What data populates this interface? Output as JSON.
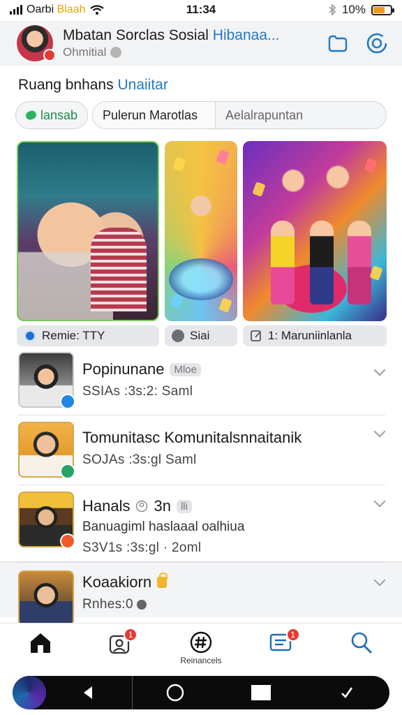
{
  "status_bar": {
    "carrier": "Oarbi",
    "carrier_accent": "Blaah",
    "time": "11:34",
    "battery_text": "10%",
    "battery_level": 0.65,
    "battery_color": "#f29a1d"
  },
  "header": {
    "title": "Mbatan Sorclas Sosial",
    "title_accent": "Hibanaa...",
    "subtitle": "Ohmitial",
    "icons": [
      "folder-icon",
      "settings-icon"
    ]
  },
  "section": {
    "title": "Ruang bnhans",
    "title_accent": "Unaiitar"
  },
  "filters": {
    "pill_1": "lansab",
    "pill_2": "Pulerun Marotlas",
    "pill_3": "Aelalrapuntan"
  },
  "media_captions": [
    {
      "label": "Remie: TTY",
      "icon": "globe-icon"
    },
    {
      "label": "Siai",
      "icon": "share-icon"
    },
    {
      "label": "1: Maruniinlanla",
      "icon": "edit-icon"
    }
  ],
  "list": [
    {
      "title": "Popinunane",
      "tag": "Mloe",
      "desc": "",
      "meta": "SSIAs :3s:2:  Saml",
      "badge_color": "#1e88e5"
    },
    {
      "title": "Tomunitasc Komunitalsnnaitanik",
      "tag": "",
      "desc": "",
      "meta": "SOJAs :3s:gl  Saml",
      "badge_color": "#25a46a"
    },
    {
      "title": "Hanals",
      "tag_icon": "person-icon",
      "tag_text": "3n",
      "tag": "lli",
      "desc": "Banuagiml haslaaal oalhiua",
      "meta": "S3V1s :3s:gl · 2oml",
      "badge_color": "#f05a28"
    },
    {
      "title": "Koaakiorn",
      "tag": "",
      "desc": "",
      "meta": "Rnhes:0",
      "badge_color": "#555555"
    }
  ],
  "tabbar": {
    "tabs": [
      {
        "icon": "home-icon",
        "label": ""
      },
      {
        "icon": "profile-icon",
        "label": "",
        "badge": "1"
      },
      {
        "icon": "hashtag-icon",
        "label": "Reinancels"
      },
      {
        "icon": "messages-icon",
        "label": "",
        "badge": "1"
      },
      {
        "icon": "search-icon",
        "label": ""
      }
    ]
  },
  "colors": {
    "accent": "#1f7ac4",
    "badge": "#e53935",
    "header_bg": "#f2f3f5"
  }
}
